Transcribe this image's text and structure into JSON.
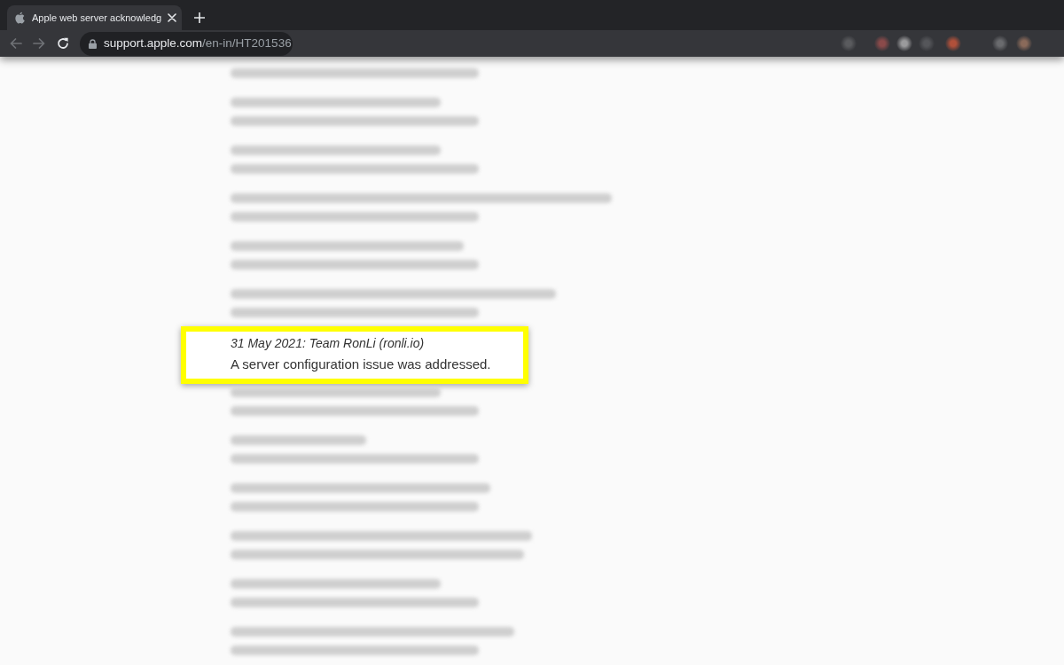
{
  "tabs": [
    {
      "title": "Apple web server acknowledg",
      "selected": true
    }
  ],
  "navigation": {
    "back": {
      "disabled": true
    },
    "forward": {
      "disabled": true
    }
  },
  "address_bar": {
    "host": "support.apple.com",
    "path": "/en-in/HT201536"
  },
  "extensions": [
    {
      "color": "#5a5b5e"
    },
    {
      "color": "#8a4a4a"
    },
    {
      "color": "#9a9a9c"
    },
    {
      "color": "#55565a"
    },
    {
      "color": "#b0503a"
    },
    {
      "color": "#6a6b6e"
    },
    {
      "color": "#8a6a5a"
    }
  ],
  "entries": [
    {
      "kind": "blurred_tail"
    },
    {
      "kind": "blurred"
    },
    {
      "kind": "blurred"
    },
    {
      "kind": "blurred"
    },
    {
      "kind": "blurred"
    },
    {
      "kind": "blurred"
    },
    {
      "kind": "highlighted",
      "heading": "31 May 2021: Team RonLi (ronli.io)",
      "text": "A server configuration issue was addressed."
    },
    {
      "kind": "blurred"
    },
    {
      "kind": "blurred"
    },
    {
      "kind": "blurred"
    },
    {
      "kind": "blurred"
    },
    {
      "kind": "blurred"
    },
    {
      "kind": "blurred"
    }
  ]
}
